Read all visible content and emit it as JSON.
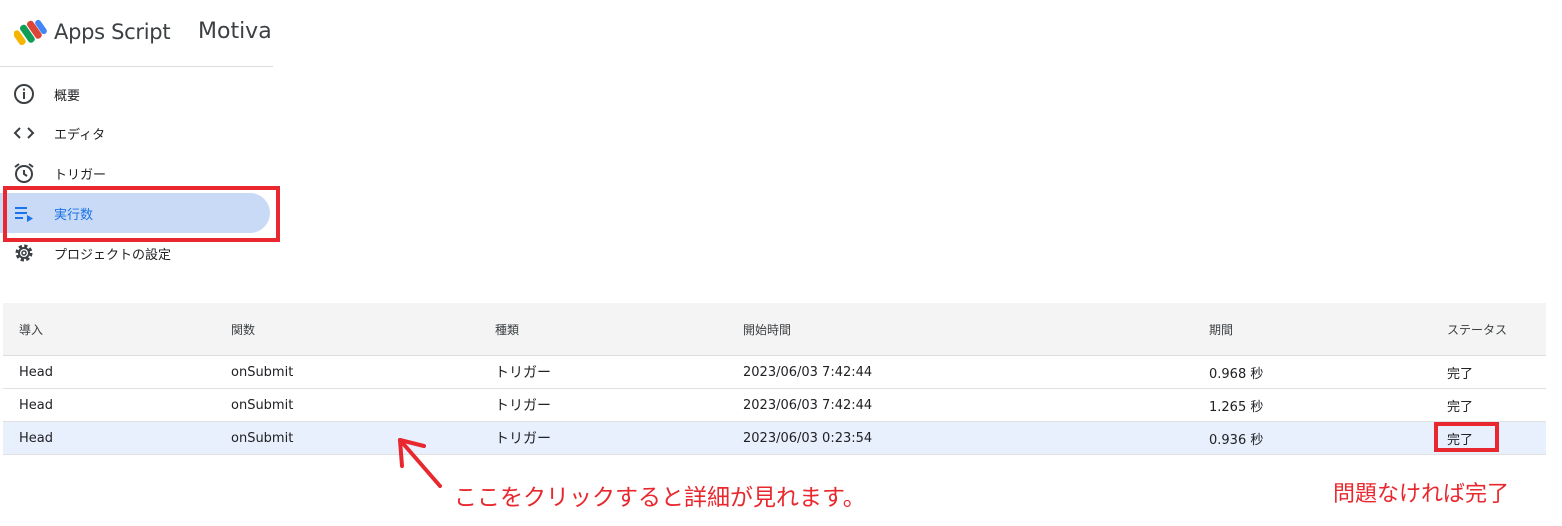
{
  "header": {
    "app_name": "Apps Script",
    "project_name": "Motiva"
  },
  "sidebar": {
    "items": [
      {
        "label": "概要",
        "icon": "info-icon"
      },
      {
        "label": "エディタ",
        "icon": "code-icon"
      },
      {
        "label": "トリガー",
        "icon": "alarm-clock-icon"
      },
      {
        "label": "実行数",
        "icon": "executions-list-icon",
        "active": true
      },
      {
        "label": "プロジェクトの設定",
        "icon": "gear-icon"
      }
    ]
  },
  "table": {
    "headers": [
      "導入",
      "関数",
      "種類",
      "開始時間",
      "期間",
      "ステータス"
    ],
    "rows": [
      {
        "deployment": "Head",
        "function": "onSubmit",
        "type": "トリガー",
        "start": "2023/06/03 7:42:44",
        "duration": "0.968 秒",
        "status": "完了"
      },
      {
        "deployment": "Head",
        "function": "onSubmit",
        "type": "トリガー",
        "start": "2023/06/03 7:42:44",
        "duration": "1.265 秒",
        "status": "完了"
      },
      {
        "deployment": "Head",
        "function": "onSubmit",
        "type": "トリガー",
        "start": "2023/06/03 0:23:54",
        "duration": "0.936 秒",
        "status": "完了"
      }
    ]
  },
  "annotations": {
    "click_note": "ここをクリックすると詳細が見れます。",
    "status_note": "問題なければ完了"
  },
  "colors": {
    "accent": "#1a73e8",
    "active_bg": "#c9daf6",
    "annotation_red": "#e8282e",
    "selected_row_bg": "#e8f0fe"
  }
}
